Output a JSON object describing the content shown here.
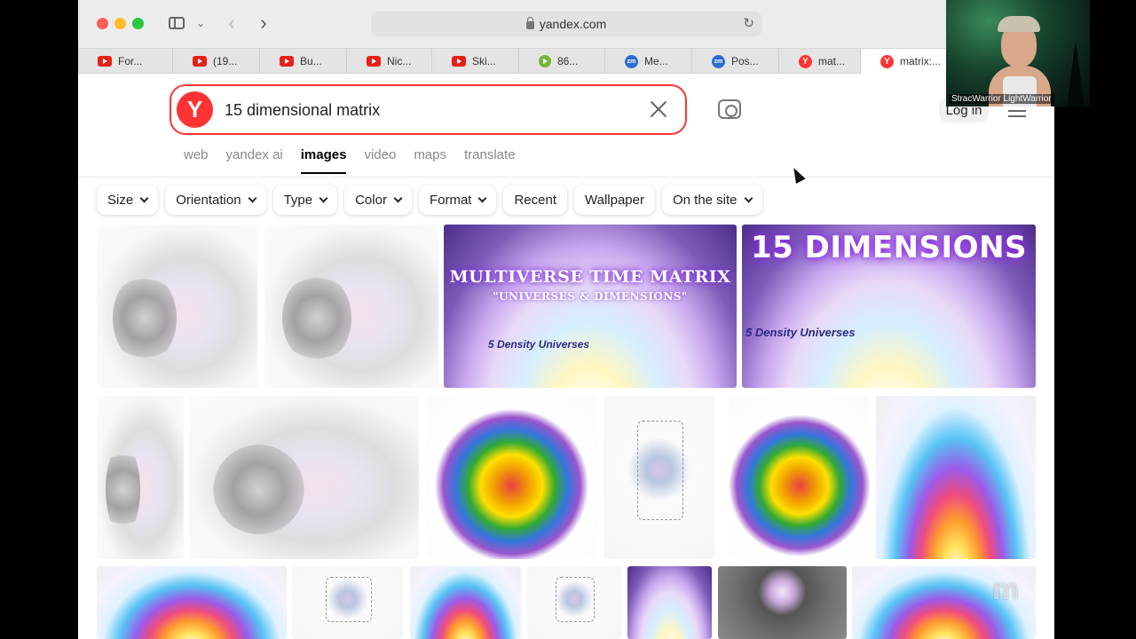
{
  "browser": {
    "address": "yandex.com",
    "tabs": [
      {
        "label": "For...",
        "favicon": "youtube-icon"
      },
      {
        "label": "(19...",
        "favicon": "youtube-icon"
      },
      {
        "label": "Bu...",
        "favicon": "youtube-icon"
      },
      {
        "label": "Nic...",
        "favicon": "youtube-icon"
      },
      {
        "label": "Ski...",
        "favicon": "youtube-icon"
      },
      {
        "label": "86...",
        "favicon": "rumble-icon"
      },
      {
        "label": "Me...",
        "favicon": "zoom-icon"
      },
      {
        "label": "Pos...",
        "favicon": "zoom-icon"
      },
      {
        "label": "mat...",
        "favicon": "yandex-icon"
      },
      {
        "label": "matrix:...",
        "favicon": "yandex-icon",
        "active": true
      }
    ]
  },
  "search": {
    "logo_letter": "Y",
    "query": "15 dimensional matrix",
    "login_label": "Log in"
  },
  "service_tabs": [
    "web",
    "yandex ai",
    "images",
    "video",
    "maps",
    "translate"
  ],
  "active_service": "images",
  "filters": [
    {
      "label": "Size",
      "has_dropdown": true
    },
    {
      "label": "Orientation",
      "has_dropdown": true
    },
    {
      "label": "Type",
      "has_dropdown": true
    },
    {
      "label": "Color",
      "has_dropdown": true
    },
    {
      "label": "Format",
      "has_dropdown": true
    },
    {
      "label": "Recent",
      "has_dropdown": false
    },
    {
      "label": "Wallpaper",
      "has_dropdown": false
    },
    {
      "label": "On the site",
      "has_dropdown": true
    }
  ],
  "thumbnails": {
    "multiverse_title": "MULTIVERSE TIME MATRIX",
    "multiverse_subtitle": "\"UNIVERSES & DIMENSIONS\"",
    "multiverse_caption": "5 Density Universes",
    "dimensions_title": "15 DIMENSIONS",
    "dimensions_caption": "5 Density Universes"
  },
  "webcam": {
    "name_label": "StracWarrior LightWarrior"
  },
  "watermark": "m"
}
